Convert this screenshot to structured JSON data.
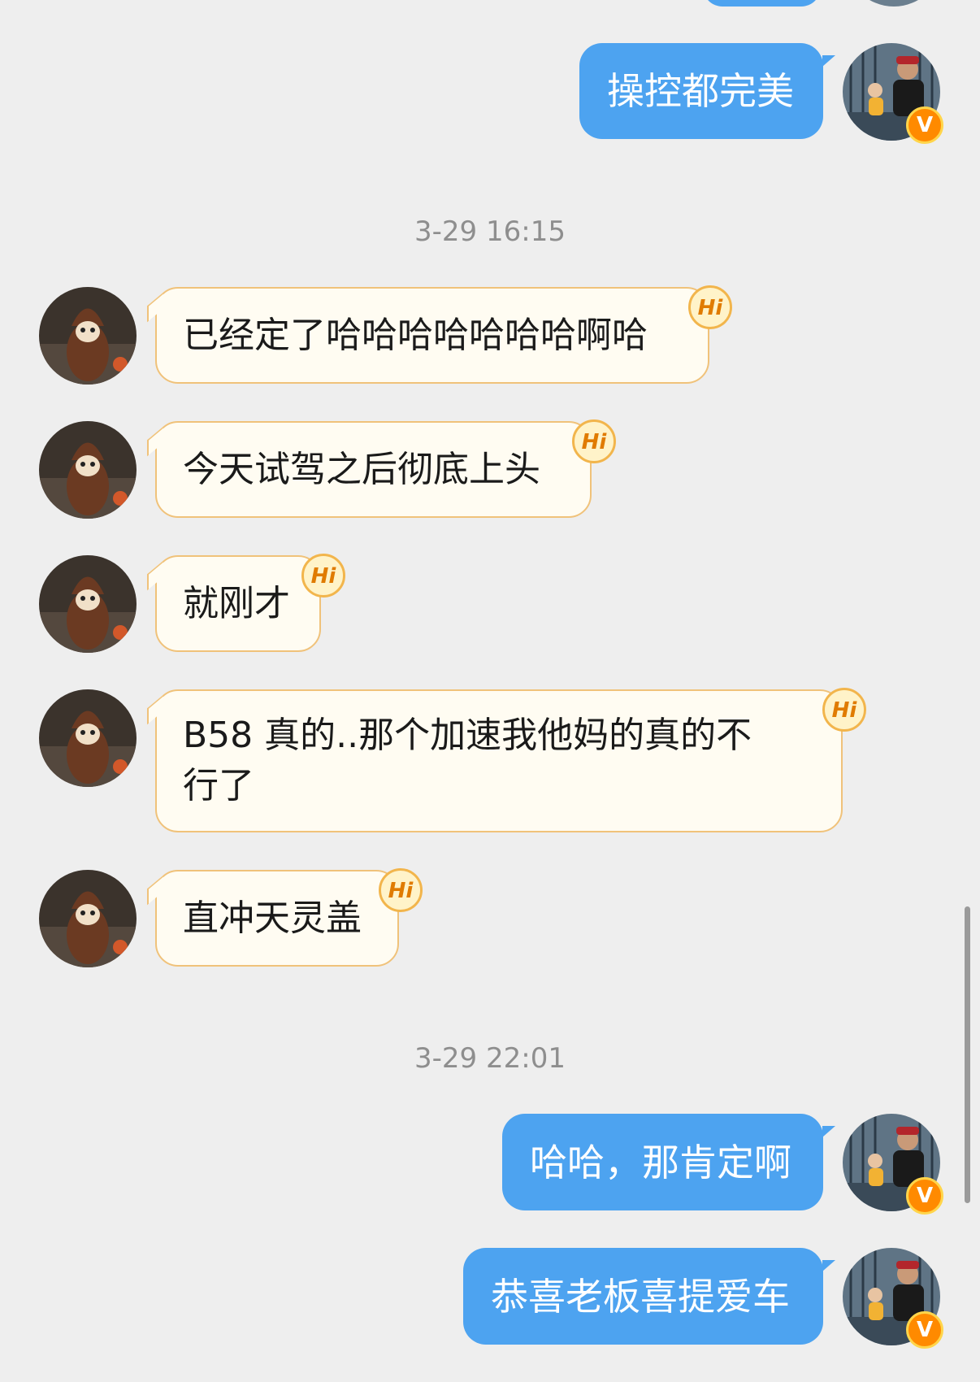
{
  "timestamps": [
    "3-29 16:15",
    "3-29 22:01"
  ],
  "messages": [
    {
      "sender": "me",
      "text": "操控都完美"
    },
    {
      "sender": "friend",
      "text": "已经定了哈哈哈哈哈哈哈啊哈"
    },
    {
      "sender": "friend",
      "text": "今天试驾之后彻底上头"
    },
    {
      "sender": "friend",
      "text": "就刚才"
    },
    {
      "sender": "friend",
      "text": "B58 真的..那个加速我他妈的真的不行了"
    },
    {
      "sender": "friend",
      "text": "直冲天灵盖"
    },
    {
      "sender": "me",
      "text": "哈哈，那肯定啊"
    },
    {
      "sender": "me",
      "text": "恭喜老板喜提爱车"
    }
  ],
  "badges": {
    "hi": "Hi",
    "verified": "V"
  },
  "icons": {
    "hi_badge": "hi-badge-icon",
    "verified_badge": "verified-badge-icon"
  },
  "colors": {
    "background": "#eeeeee",
    "outgoing_bubble": "#4da3f0",
    "incoming_bubble": "#fffcf2",
    "incoming_border": "#f0c27a",
    "timestamp": "#8e8e8e"
  }
}
